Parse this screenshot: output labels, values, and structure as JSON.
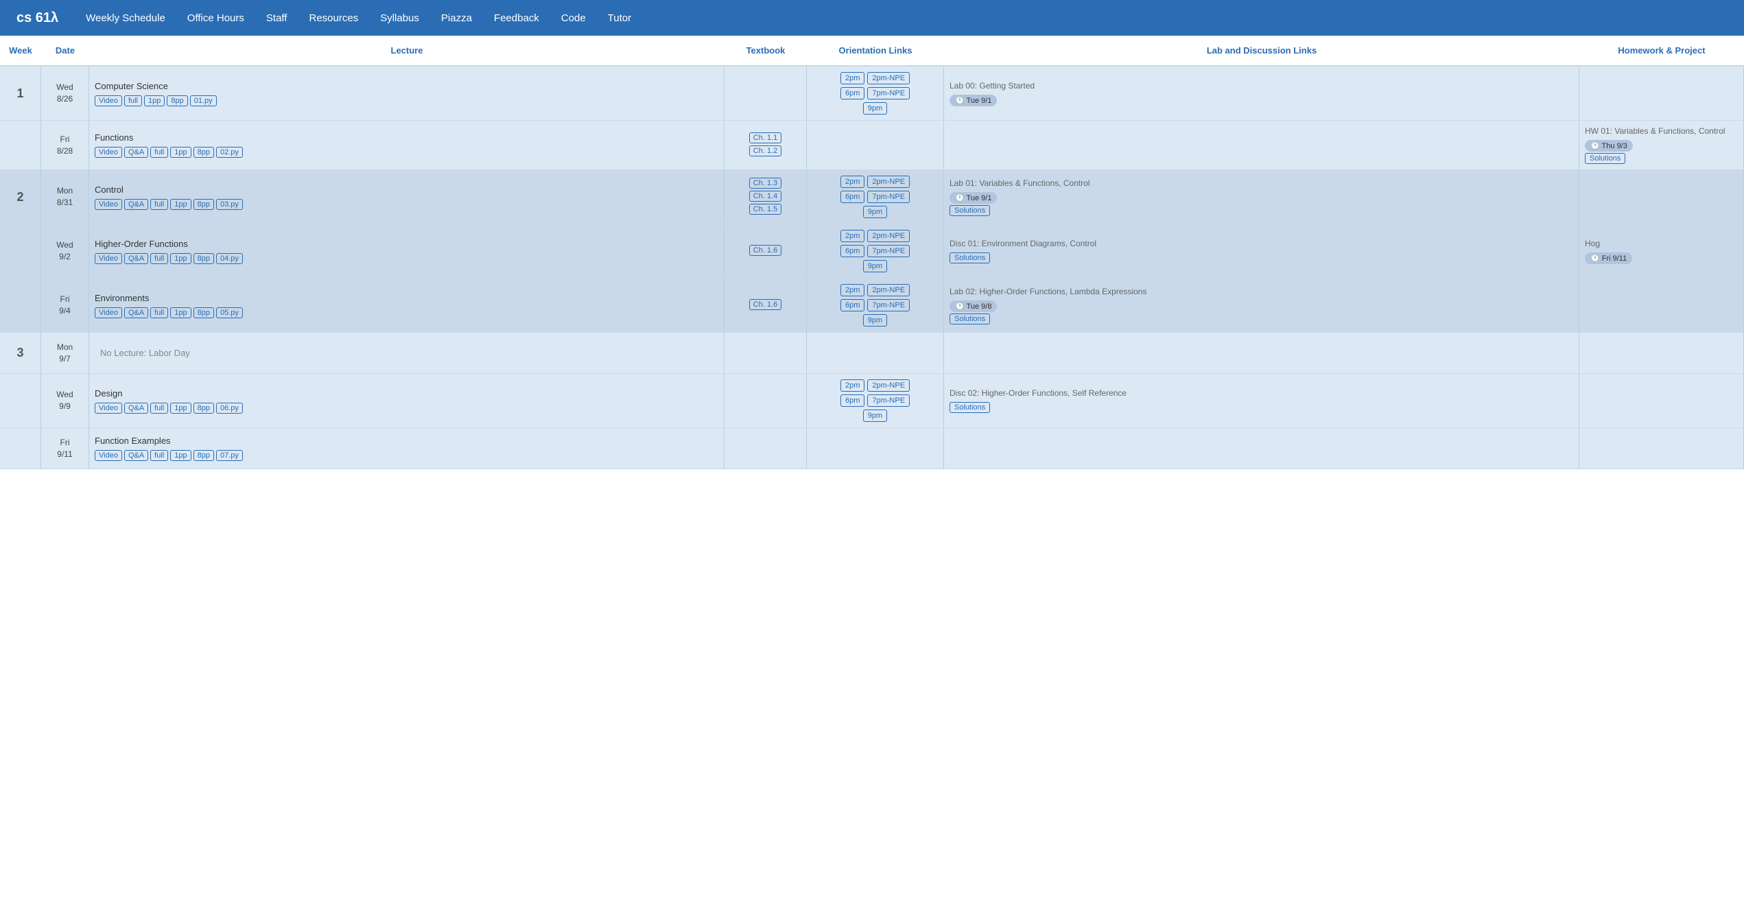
{
  "nav": {
    "logo": "cs 61λ",
    "links": [
      "Weekly Schedule",
      "Office Hours",
      "Staff",
      "Resources",
      "Syllabus",
      "Piazza",
      "Feedback",
      "Code",
      "Tutor"
    ]
  },
  "tableHeader": {
    "columns": [
      "Week",
      "Date",
      "Lecture",
      "Textbook",
      "Orientation Links",
      "Lab and Discussion Links",
      "Homework & Project"
    ]
  },
  "weeks": [
    {
      "weekNum": "1",
      "rows": [
        {
          "date": "Wed\n8/26",
          "lecture": "Computer Science",
          "lectureTags": [
            "Video",
            "full",
            "1pp",
            "8pp",
            "01.py"
          ],
          "textbook": "",
          "orientLinks": [
            [
              "2pm",
              "2pm-NPE"
            ],
            [
              "6pm",
              "7pm-NPE"
            ],
            [
              "9pm"
            ]
          ],
          "labTitle": "Lab 00: Getting Started",
          "labDue": "Tue 9/1",
          "labSolutions": false,
          "hw": "",
          "bg": "light"
        },
        {
          "date": "Fri\n8/28",
          "lecture": "Functions",
          "lectureTags": [
            "Video",
            "Q&A",
            "full",
            "1pp",
            "8pp",
            "02.py"
          ],
          "textbook": "Ch. 1.1\nCh. 1.2",
          "orientLinks": [],
          "labTitle": "",
          "labDue": "",
          "labSolutions": false,
          "hw": "HW 01: Variables & Functions, Control",
          "hwDue": "Thu 9/3",
          "hwSolutions": true,
          "bg": "light"
        }
      ]
    },
    {
      "weekNum": "2",
      "rows": [
        {
          "date": "Mon\n8/31",
          "lecture": "Control",
          "lectureTags": [
            "Video",
            "Q&A",
            "full",
            "1pp",
            "8pp",
            "03.py"
          ],
          "textbook": "Ch. 1.3\nCh. 1.4\nCh. 1.5",
          "orientLinks": [
            [
              "2pm",
              "2pm-NPE"
            ],
            [
              "6pm",
              "7pm-NPE"
            ],
            [
              "9pm"
            ]
          ],
          "labTitle": "Lab 01: Variables & Functions, Control",
          "labDue": "Tue 9/1",
          "labSolutions": true,
          "hw": "",
          "bg": "medium"
        },
        {
          "date": "Wed\n9/2",
          "lecture": "Higher-Order Functions",
          "lectureTags": [
            "Video",
            "Q&A",
            "full",
            "1pp",
            "8pp",
            "04.py"
          ],
          "textbook": "Ch. 1.6",
          "orientLinks": [
            [
              "2pm",
              "2pm-NPE"
            ],
            [
              "6pm",
              "7pm-NPE"
            ],
            [
              "9pm"
            ]
          ],
          "labTitle": "Disc 01: Environment Diagrams, Control",
          "labDue": "",
          "labSolutions": true,
          "hw": "Hog",
          "hwDue": "Fri 9/11",
          "hwSolutions": false,
          "bg": "medium"
        },
        {
          "date": "Fri\n9/4",
          "lecture": "Environments",
          "lectureTags": [
            "Video",
            "Q&A",
            "full",
            "1pp",
            "8pp",
            "05.py"
          ],
          "textbook": "Ch. 1.6",
          "orientLinks": [
            [
              "2pm",
              "2pm-NPE"
            ],
            [
              "6pm",
              "7pm-NPE"
            ],
            [
              "9pm"
            ]
          ],
          "labTitle": "Lab 02: Higher-Order Functions, Lambda Expressions",
          "labDue": "Tue 9/8",
          "labSolutions": true,
          "hw": "",
          "bg": "medium"
        }
      ]
    },
    {
      "weekNum": "3",
      "rows": [
        {
          "date": "Mon\n9/7",
          "lecture": "No Lecture: Labor Day",
          "lectureTags": [],
          "textbook": "",
          "orientLinks": [],
          "labTitle": "",
          "labDue": "",
          "labSolutions": false,
          "hw": "",
          "bg": "light",
          "noLecture": true
        },
        {
          "date": "Wed\n9/9",
          "lecture": "Design",
          "lectureTags": [
            "Video",
            "Q&A",
            "full",
            "1pp",
            "8pp",
            "06.py"
          ],
          "textbook": "",
          "orientLinks": [
            [
              "2pm",
              "2pm-NPE"
            ],
            [
              "6pm",
              "7pm-NPE"
            ],
            [
              "9pm"
            ]
          ],
          "labTitle": "Disc 02: Higher-Order Functions, Self Reference",
          "labDue": "",
          "labSolutions": true,
          "hw": "",
          "bg": "light"
        },
        {
          "date": "Fri\n9/11",
          "lecture": "Function Examples",
          "lectureTags": [
            "Video",
            "Q&A",
            "full",
            "1pp",
            "8pp",
            "07.py"
          ],
          "textbook": "",
          "orientLinks": [],
          "labTitle": "",
          "labDue": "",
          "labSolutions": false,
          "hw": "",
          "bg": "light"
        }
      ]
    }
  ]
}
